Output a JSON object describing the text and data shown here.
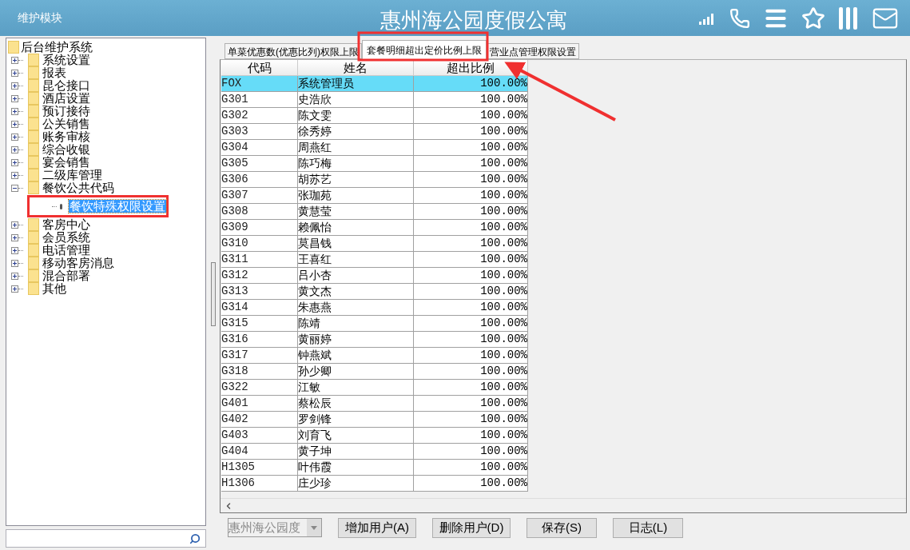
{
  "window": {
    "module": "维护模块",
    "title": "惠州海公园度假公寓"
  },
  "tree": {
    "label": "后台维护系统",
    "children": [
      {
        "label": "系统设置",
        "expanded": false,
        "selected": false
      },
      {
        "label": "报表",
        "expanded": false,
        "selected": false
      },
      {
        "label": "昆仑接口",
        "expanded": false,
        "selected": false
      },
      {
        "label": "酒店设置",
        "expanded": false,
        "selected": false
      },
      {
        "label": "预订接待",
        "expanded": false,
        "selected": false
      },
      {
        "label": "公关销售",
        "expanded": false,
        "selected": false
      },
      {
        "label": "账务审核",
        "expanded": false,
        "selected": false
      },
      {
        "label": "综合收银",
        "expanded": false,
        "selected": false
      },
      {
        "label": "宴会销售",
        "expanded": false,
        "selected": false
      },
      {
        "label": "二级库管理",
        "expanded": false,
        "selected": false
      },
      {
        "label": "餐饮公共代码",
        "expanded": true,
        "selected": false,
        "children": [
          {
            "label": "餐饮特殊权限设置",
            "selected": true
          }
        ]
      },
      {
        "label": "客房中心",
        "expanded": false,
        "selected": false
      },
      {
        "label": "会员系统",
        "expanded": false,
        "selected": false
      },
      {
        "label": "电话管理",
        "expanded": false,
        "selected": false
      },
      {
        "label": "移动客房消息",
        "expanded": false,
        "selected": false
      },
      {
        "label": "混合部署",
        "expanded": false,
        "selected": false
      },
      {
        "label": "其他",
        "expanded": false,
        "selected": false
      }
    ]
  },
  "tabs": [
    {
      "label": "单菜优惠数(优惠比列)权限上限",
      "selected": false
    },
    {
      "label": "套餐明细超出定价比例上限",
      "selected": true
    },
    {
      "label": "营业点管理权限设置",
      "selected": false
    }
  ],
  "table": {
    "columns": [
      "代码",
      "姓名",
      "超出比例"
    ],
    "rows": [
      {
        "code": "FOX",
        "name": "系统管理员",
        "ratio": "100.00%",
        "selected": true
      },
      {
        "code": "G301",
        "name": "史浩欣",
        "ratio": "100.00%",
        "selected": false
      },
      {
        "code": "G302",
        "name": "陈文雯",
        "ratio": "100.00%",
        "selected": false
      },
      {
        "code": "G303",
        "name": "徐秀婷",
        "ratio": "100.00%",
        "selected": false
      },
      {
        "code": "G304",
        "name": "周燕红",
        "ratio": "100.00%",
        "selected": false
      },
      {
        "code": "G305",
        "name": "陈巧梅",
        "ratio": "100.00%",
        "selected": false
      },
      {
        "code": "G306",
        "name": "胡苏艺",
        "ratio": "100.00%",
        "selected": false
      },
      {
        "code": "G307",
        "name": "张珈苑",
        "ratio": "100.00%",
        "selected": false
      },
      {
        "code": "G308",
        "name": "黄慧莹",
        "ratio": "100.00%",
        "selected": false
      },
      {
        "code": "G309",
        "name": "赖佩怡",
        "ratio": "100.00%",
        "selected": false
      },
      {
        "code": "G310",
        "name": "莫昌钱",
        "ratio": "100.00%",
        "selected": false
      },
      {
        "code": "G311",
        "name": "王喜红",
        "ratio": "100.00%",
        "selected": false
      },
      {
        "code": "G312",
        "name": "吕小杏",
        "ratio": "100.00%",
        "selected": false
      },
      {
        "code": "G313",
        "name": "黄文杰",
        "ratio": "100.00%",
        "selected": false
      },
      {
        "code": "G314",
        "name": "朱惠燕",
        "ratio": "100.00%",
        "selected": false
      },
      {
        "code": "G315",
        "name": "陈靖",
        "ratio": "100.00%",
        "selected": false
      },
      {
        "code": "G316",
        "name": "黄丽婷",
        "ratio": "100.00%",
        "selected": false
      },
      {
        "code": "G317",
        "name": "钟燕斌",
        "ratio": "100.00%",
        "selected": false
      },
      {
        "code": "G318",
        "name": "孙少卿",
        "ratio": "100.00%",
        "selected": false
      },
      {
        "code": "G322",
        "name": "江敏",
        "ratio": "100.00%",
        "selected": false
      },
      {
        "code": "G401",
        "name": "蔡松辰",
        "ratio": "100.00%",
        "selected": false
      },
      {
        "code": "G402",
        "name": "罗剑锋",
        "ratio": "100.00%",
        "selected": false
      },
      {
        "code": "G403",
        "name": "刘育飞",
        "ratio": "100.00%",
        "selected": false
      },
      {
        "code": "G404",
        "name": "黄子坤",
        "ratio": "100.00%",
        "selected": false
      },
      {
        "code": "H1305",
        "name": "叶伟霞",
        "ratio": "100.00%",
        "selected": false
      },
      {
        "code": "H1306",
        "name": "庄少珍",
        "ratio": "100.00%",
        "selected": false
      }
    ]
  },
  "footer": {
    "dropdown": {
      "value": "惠州海公园度",
      "disabled": true
    },
    "buttons": [
      "增加用户(A)",
      "删除用户(D)",
      "保存(S)",
      "日志(L)"
    ]
  }
}
